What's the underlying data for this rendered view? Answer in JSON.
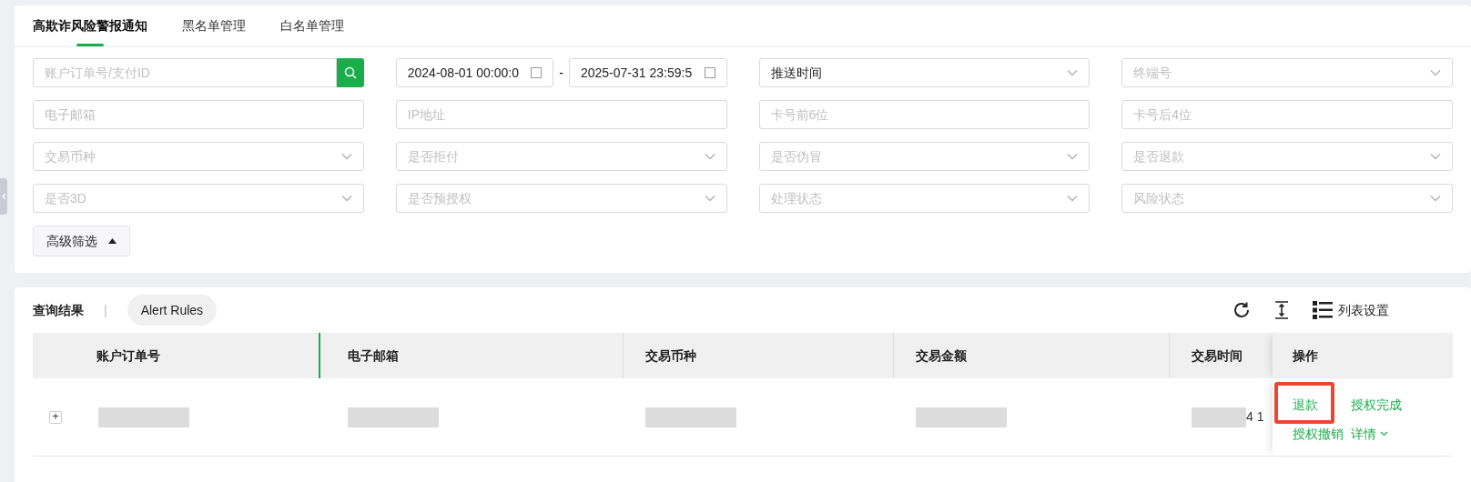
{
  "tabs": [
    {
      "label": "高欺诈风险警报通知",
      "selected": true
    },
    {
      "label": "黑名单管理",
      "selected": false
    },
    {
      "label": "白名单管理",
      "selected": false
    }
  ],
  "filters": [
    {
      "kind": "search",
      "placeholder": "账户订单号/支付ID"
    },
    {
      "kind": "date_range",
      "start": "2024-08-01 00:00:0",
      "separator": "-",
      "end": "2025-07-31 23:59:5"
    },
    {
      "kind": "select",
      "value": "推送时间"
    },
    {
      "kind": "select",
      "placeholder": "终端号"
    },
    {
      "kind": "input",
      "placeholder": "电子邮箱"
    },
    {
      "kind": "input",
      "placeholder": "IP地址"
    },
    {
      "kind": "input",
      "placeholder": "卡号前6位"
    },
    {
      "kind": "input",
      "placeholder": "卡号后4位"
    },
    {
      "kind": "select",
      "placeholder": "交易币种"
    },
    {
      "kind": "select",
      "placeholder": "是否拒付"
    },
    {
      "kind": "select",
      "placeholder": "是否伪冒"
    },
    {
      "kind": "select",
      "placeholder": "是否退款"
    },
    {
      "kind": "select",
      "placeholder": "是否3D"
    },
    {
      "kind": "select",
      "placeholder": "是否预授权"
    },
    {
      "kind": "select",
      "placeholder": "处理状态"
    },
    {
      "kind": "select",
      "placeholder": "风险状态"
    }
  ],
  "advanced_filter": {
    "label": "高级筛选",
    "expanded": true
  },
  "results": {
    "title": "查询结果",
    "separator": "|",
    "alert_rules": "Alert Rules",
    "settings_label": "列表设置",
    "columns": [
      "账户订单号",
      "电子邮箱",
      "交易币种",
      "交易金额",
      "交易时间",
      "操作"
    ],
    "rows": [
      {
        "expand": "+",
        "cells": [
          {
            "kind": "redacted"
          },
          {
            "kind": "redacted"
          },
          {
            "kind": "redacted"
          },
          {
            "kind": "redacted"
          },
          {
            "kind": "redacted",
            "text": "4 1"
          }
        ],
        "actions": [
          {
            "label": "退款",
            "highlighted": true
          },
          {
            "label": "授权完成",
            "highlighted": false
          },
          {
            "label": "授权撤销",
            "highlighted": false
          },
          {
            "label": "详情",
            "highlighted": false,
            "dropdown": true
          }
        ]
      }
    ]
  }
}
